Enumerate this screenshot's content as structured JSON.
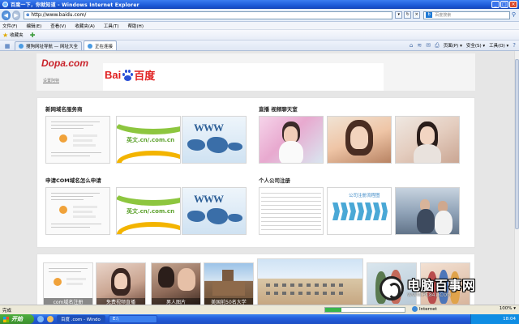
{
  "window": {
    "title": "百度一下，你就知道 - Windows Internet Explorer",
    "min": "_",
    "max": "□",
    "close": "×"
  },
  "address": {
    "url": "http://www.baidu.com/",
    "search_placeholder": "百度搜索",
    "search_engine": "b"
  },
  "menu": [
    "文件(F)",
    "编辑(E)",
    "查看(V)",
    "收藏夹(A)",
    "工具(T)",
    "帮助(H)"
  ],
  "favorites": {
    "label": "收藏夹"
  },
  "tabs": [
    {
      "label": "搜狗网址导航 — 网址大全",
      "active": false
    },
    {
      "label": "正在连接",
      "active": true
    }
  ],
  "command_bar": {
    "page": "页面(P) ▾",
    "safety": "安全(S) ▾",
    "tools": "工具(O) ▾",
    "help": "?"
  },
  "page": {
    "dopa_logo": "Dopa.com",
    "dopa_link": "设置阿特",
    "baidu_text_left": "Bai",
    "baidu_text_right": "百度",
    "baidu_du": "du",
    "sections": [
      {
        "title": "新网域名服务商"
      },
      {
        "title": "直播 视频聊天室"
      },
      {
        "title": "申请COM域名怎么申请"
      },
      {
        "title": "个人公司注册"
      }
    ],
    "domain_text": "英文.cn/.com.cn",
    "www_text": "WWW",
    "flow_title": "公司注册流程图",
    "bottom_captions": [
      "com域名注册",
      "免费视频直播",
      "男人图片",
      "美国前50名大学"
    ]
  },
  "watermark": {
    "main": "电脑百事网",
    "sub": "WWW.PC841.COM"
  },
  "status": {
    "text": "完成",
    "zone": "Internet",
    "zoom": "100% ▾",
    "progress": 0.2
  },
  "taskbar": {
    "start": "开始",
    "tasks": [
      "百度 .com - Windo",
      "E:\\"
    ],
    "clock": "18:04"
  }
}
